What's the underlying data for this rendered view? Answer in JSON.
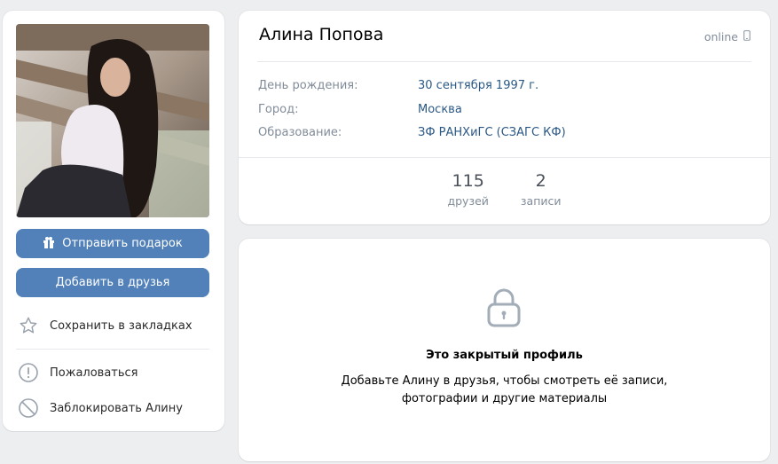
{
  "left": {
    "photo_alt": "",
    "gift_button": "Отправить подарок",
    "add_friend_button": "Добавить в друзья",
    "bookmark": "Сохранить в закладках",
    "report": "Пожаловаться",
    "block": "Заблокировать Алину"
  },
  "profile": {
    "name": "Алина Попова",
    "online": "online",
    "info": [
      {
        "label": "День рождения:",
        "value": "30 сентября 1997 г."
      },
      {
        "label": "Город:",
        "value": "Москва"
      },
      {
        "label": "Образование:",
        "value": "ЗФ РАНХиГС (СЗАГС КФ)"
      }
    ],
    "counters": [
      {
        "num": "115",
        "label": "друзей"
      },
      {
        "num": "2",
        "label": "записи"
      }
    ]
  },
  "closed": {
    "title": "Это закрытый профиль",
    "line1": "Добавьте Алину в друзья, чтобы смотреть её записи,",
    "line2": "фотографии и другие материалы"
  },
  "colors": {
    "accent": "#5181b8",
    "link": "#2a5885",
    "muted": "#818c99",
    "background": "#edeef0"
  }
}
